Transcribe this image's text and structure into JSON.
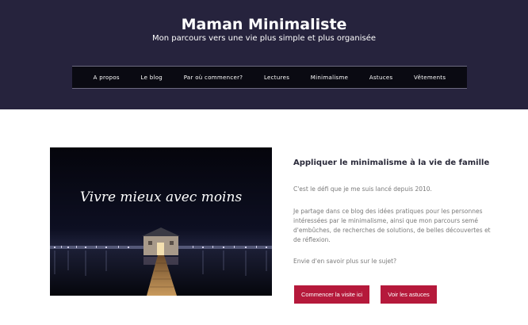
{
  "header": {
    "title": "Maman Minimaliste",
    "tagline": "Mon parcours vers une vie plus simple et plus organisée"
  },
  "nav": {
    "items": [
      "A propos",
      "Le blog",
      "Par où commencer?",
      "Lectures",
      "Minimalisme",
      "Astuces",
      "Vêtements"
    ]
  },
  "hero": {
    "caption": "Vivre mieux avec moins"
  },
  "article": {
    "title": "Appliquer le minimalisme à la vie de famille",
    "p1": "C'est le défi que je me suis lancé depuis 2010.",
    "p2": "Je partage dans ce blog des idées pratiques pour les personnes intéressées par le minimalisme, ainsi que mon parcours semé d'embûches, de recherches de solutions, de belles découvertes et de réflexion.",
    "p3": "Envie d'en savoir plus sur le sujet?"
  },
  "buttons": {
    "start": "Commencer la visite ici",
    "tips": "Voir les astuces"
  },
  "colors": {
    "header_bg": "#26233d",
    "nav_bg": "#0a0a12",
    "accent": "#b5193b"
  }
}
